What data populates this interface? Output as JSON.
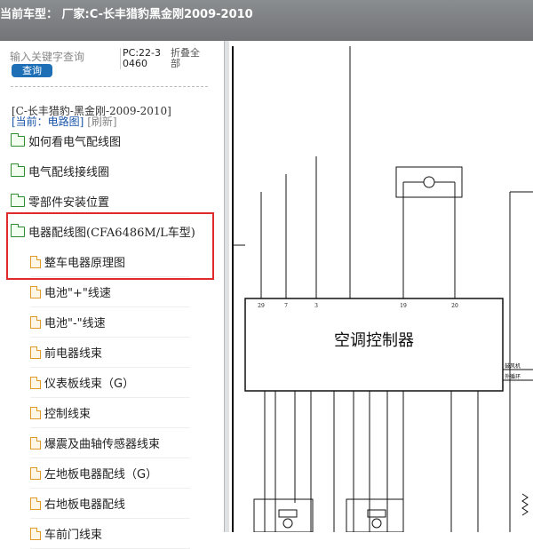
{
  "title_bar": {
    "text": "当前车型： 厂家:C-长丰猎豹黑金刚2009-2010"
  },
  "search": {
    "placeholder": "输入关键字查询",
    "button_label": "查询"
  },
  "pc_code": "PC:22-30460",
  "collapse_all_label": "折叠全部",
  "vehicle_label": "[C-长丰猎豹-黑金刚-2009-2010]",
  "current": {
    "label": "[当前：电路图]",
    "refresh": "[刷新]"
  },
  "tree": {
    "folders": [
      "如何看电气配线图",
      "电气配线接线圈",
      "零部件安装位置",
      "电器配线图(CFA6486M/L车型)"
    ],
    "children": [
      "整车电器原理图",
      "电池\"+\"线速",
      "电池\"-\"线速",
      "前电器线束",
      "仪表板线束（G）",
      "控制线束",
      "爆震及曲轴传感器线束",
      "左地板电器配线（G）",
      "右地板电器配线",
      "车前门线束"
    ]
  },
  "diagram": {
    "controller_label": "空调控制器",
    "top_pin_labels": [
      "29",
      "7",
      "3",
      "19",
      "20"
    ],
    "right_labels": [
      "鼓风机",
      "外循环"
    ],
    "colors": {
      "line": "#111111",
      "highlight": "#e02a2a",
      "accent": "#1f6fb7"
    }
  }
}
